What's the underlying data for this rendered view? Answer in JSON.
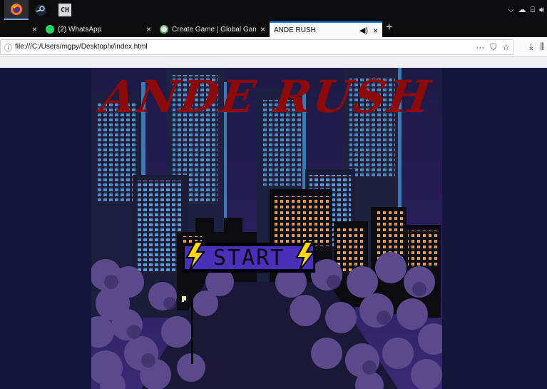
{
  "taskbar": {
    "apps": [
      {
        "name": "firefox-icon",
        "active": true
      },
      {
        "name": "steam-icon",
        "active": false
      },
      {
        "name": "ch-icon",
        "label": "CH",
        "active": false
      }
    ],
    "tray": {
      "icons": [
        "chevron-up-icon",
        "cloud-icon",
        "network-icon",
        "volume-icon"
      ]
    }
  },
  "tabs": [
    {
      "label": "",
      "close": "×"
    },
    {
      "label": "(2) WhatsApp",
      "close": "×"
    },
    {
      "label": "Create Game | Global Game Jam",
      "close": "×"
    },
    {
      "label": "ANDE RUSH",
      "close": "×",
      "active": true
    }
  ],
  "newtab": "+",
  "urlbar": {
    "url": "file:///C:/Users/mgpy/Desktop/x/index.html",
    "icons": [
      "info-icon",
      "more-icon",
      "pocket-icon",
      "bookmark-star-icon"
    ]
  },
  "game": {
    "title": "ANDE RUSH",
    "start_label": "START"
  },
  "colors": {
    "sky": "#1b1a44",
    "title": "#8c0a0a",
    "button": "#4a2fb8",
    "bolt": "#ffd800",
    "window_blue": "#4aa0e0",
    "window_orange": "#e0a040"
  }
}
